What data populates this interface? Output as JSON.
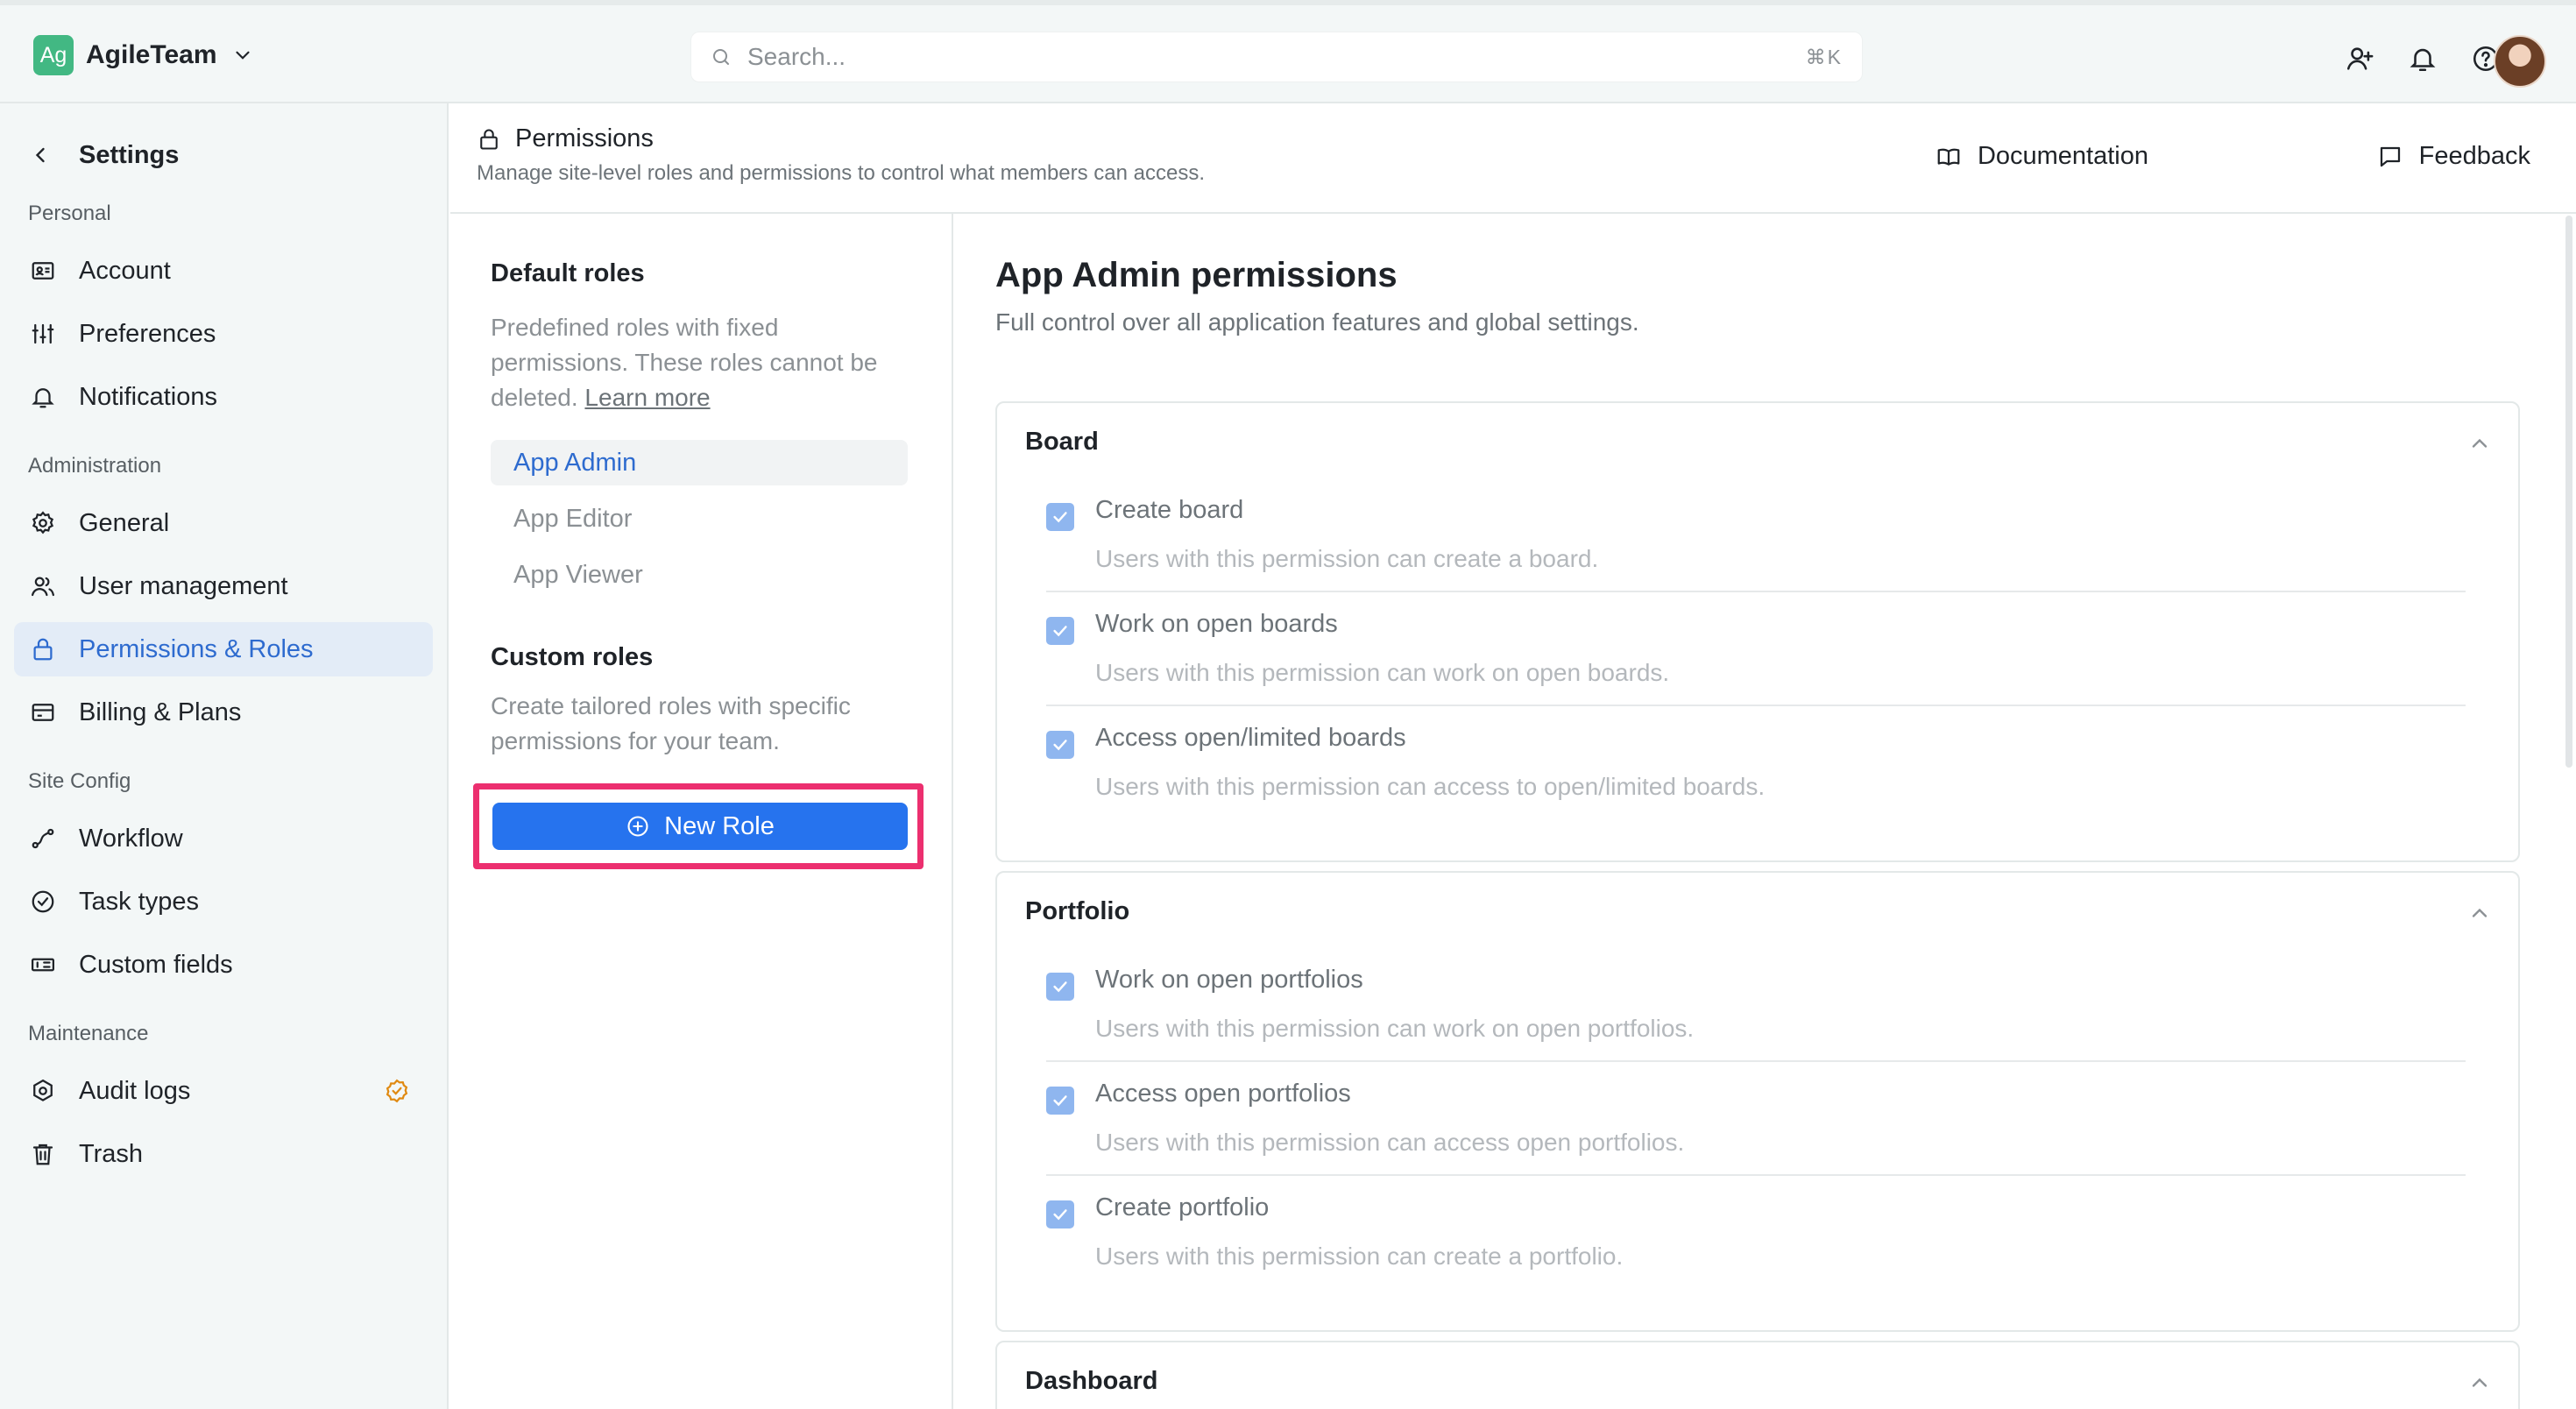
{
  "workspace": {
    "avatar_text": "Ag",
    "name": "AgileTeam"
  },
  "search": {
    "placeholder": "Search...",
    "shortcut": "⌘K"
  },
  "topbar_icons": [
    "add-user-icon",
    "bell-icon",
    "help-icon",
    "user-avatar"
  ],
  "sidebar": {
    "title": "Settings",
    "sections": [
      {
        "label": "Personal",
        "items": [
          {
            "label": "Account",
            "icon": "id-card-icon"
          },
          {
            "label": "Preferences",
            "icon": "sliders-icon"
          },
          {
            "label": "Notifications",
            "icon": "bell-icon"
          }
        ]
      },
      {
        "label": "Administration",
        "items": [
          {
            "label": "General",
            "icon": "gear-icon"
          },
          {
            "label": "User management",
            "icon": "users-icon"
          },
          {
            "label": "Permissions & Roles",
            "icon": "lock-icon",
            "active": true
          },
          {
            "label": "Billing & Plans",
            "icon": "card-icon"
          }
        ]
      },
      {
        "label": "Site Config",
        "items": [
          {
            "label": "Workflow",
            "icon": "workflow-icon"
          },
          {
            "label": "Task types",
            "icon": "check-circle-icon"
          },
          {
            "label": "Custom fields",
            "icon": "fields-icon"
          }
        ]
      },
      {
        "label": "Maintenance",
        "items": [
          {
            "label": "Audit logs",
            "icon": "audit-icon",
            "badge": "verified-badge-icon"
          },
          {
            "label": "Trash",
            "icon": "trash-icon"
          }
        ]
      }
    ]
  },
  "header": {
    "title": "Permissions",
    "subtitle": "Manage site-level roles and permissions to control what members can access.",
    "documentation": "Documentation",
    "feedback": "Feedback"
  },
  "roles": {
    "default_title": "Default roles",
    "default_desc": "Predefined roles with fixed permissions. These roles cannot be deleted.",
    "learn_more": "Learn more",
    "default_items": [
      "App Admin",
      "App Editor",
      "App Viewer"
    ],
    "active_role": "App Admin",
    "custom_title": "Custom roles",
    "custom_desc": "Create tailored roles with specific permissions for your team.",
    "new_role": "New Role"
  },
  "main": {
    "title": "App Admin permissions",
    "subtitle": "Full control over all application features and global settings.",
    "groups": [
      {
        "name": "Board",
        "permissions": [
          {
            "label": "Create board",
            "desc": "Users with this permission can create a board.",
            "checked": true
          },
          {
            "label": "Work on open boards",
            "desc": "Users with this permission can work on open boards.",
            "checked": true
          },
          {
            "label": "Access open/limited boards",
            "desc": "Users with this permission can access to open/limited boards.",
            "checked": true
          }
        ]
      },
      {
        "name": "Portfolio",
        "permissions": [
          {
            "label": "Work on open portfolios",
            "desc": "Users with this permission can work on open portfolios.",
            "checked": true
          },
          {
            "label": "Access open portfolios",
            "desc": "Users with this permission can access open portfolios.",
            "checked": true
          },
          {
            "label": "Create portfolio",
            "desc": "Users with this permission can create a portfolio.",
            "checked": true
          }
        ]
      },
      {
        "name": "Dashboard",
        "permissions": []
      }
    ]
  },
  "colors": {
    "accent": "#2673ee",
    "highlight": "#ec2f6f",
    "active_bg": "#e3ecf7",
    "checkbox": "#8fb6ef"
  }
}
